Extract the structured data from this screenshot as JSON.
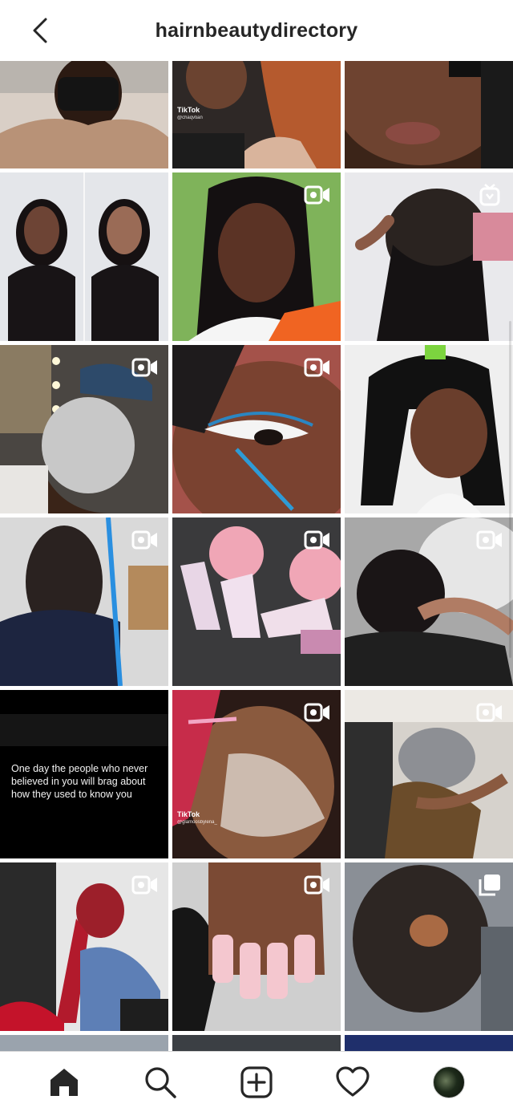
{
  "header": {
    "title": "hairnbeautydirectory"
  },
  "icons": {
    "back": "chevron-left-icon",
    "video": "video-camera-icon",
    "igtv": "igtv-icon",
    "carousel": "carousel-icon",
    "home": "home-icon",
    "search": "search-icon",
    "new_post": "new-post-icon",
    "activity": "heart-icon",
    "profile": "profile-avatar"
  },
  "posts": {
    "tiktok_label": "TikTok",
    "tiktok_handle_1": "@chaqvtian",
    "tiktok_handle_2": "@glamoosbylena_",
    "quote": "One day the people who never believed in you will brag about how they used to know you"
  },
  "colors": {
    "background": "#ffffff",
    "text": "#262626",
    "divider": "#dbdbdb"
  }
}
